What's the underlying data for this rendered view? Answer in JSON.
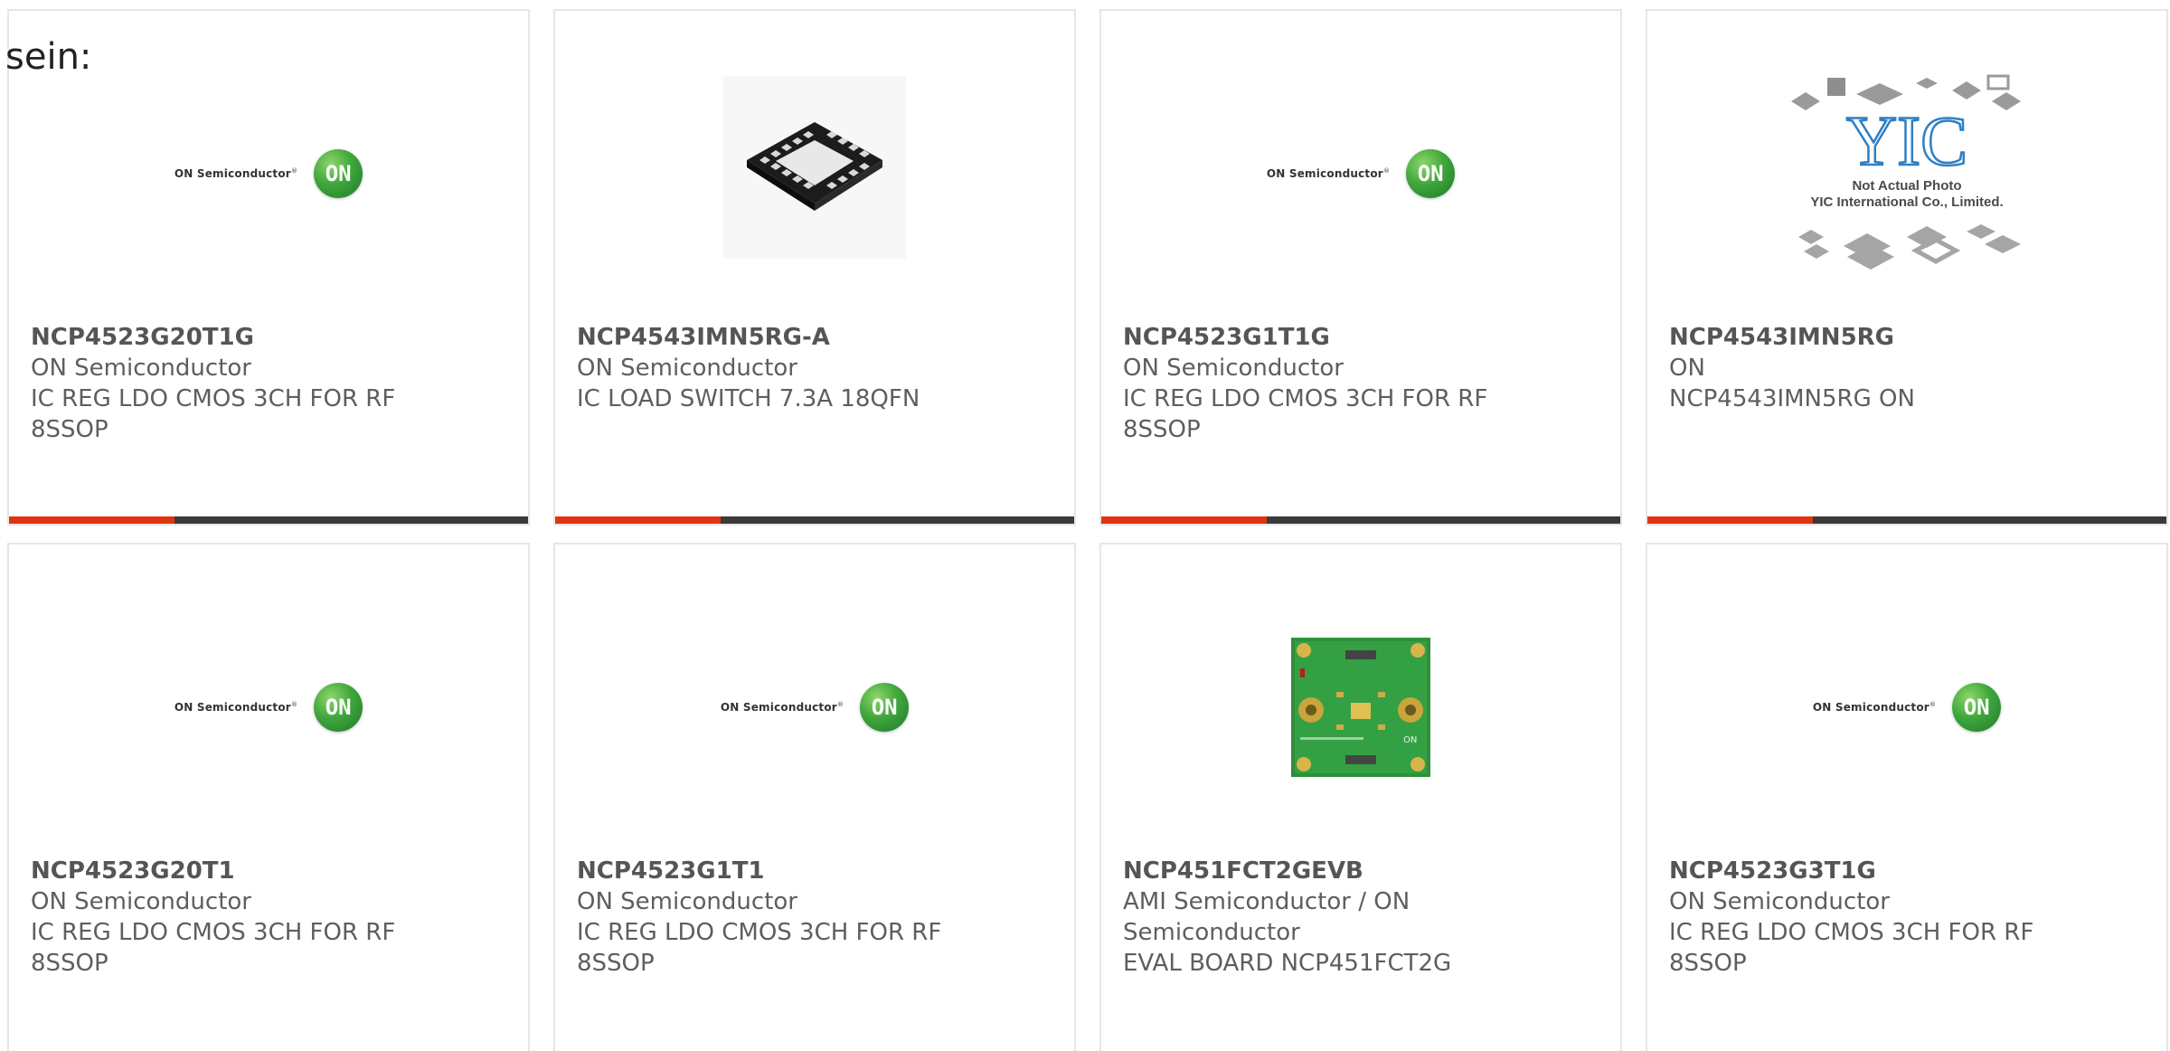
{
  "page": {
    "lead_text": "sein:"
  },
  "brand_logo": {
    "wordmark": "ON Semiconductor",
    "registered": "®",
    "disc_text": "ON",
    "disc_color": "#3fa63c"
  },
  "placeholder_image": {
    "brand": "YIC",
    "caption_line1": "Not Actual Photo",
    "caption_line2": "YIC International Co., Limited."
  },
  "board_image": {
    "silk_label": "ON"
  },
  "accent_colors": {
    "bar_accent": "#e03412",
    "bar_base": "#3a3a3a"
  },
  "products": [
    {
      "part_number": "NCP4523G20T1G",
      "manufacturer": "ON Semiconductor",
      "description": "IC REG LDO CMOS 3CH FOR RF 8SSOP",
      "image": "on-semi-logo"
    },
    {
      "part_number": "NCP4543IMN5RG-A",
      "manufacturer": "ON Semiconductor",
      "description": "IC LOAD SWITCH 7.3A 18QFN",
      "image": "qfn-chip"
    },
    {
      "part_number": "NCP4523G1T1G",
      "manufacturer": "ON Semiconductor",
      "description": "IC REG LDO CMOS 3CH FOR RF 8SSOP",
      "image": "on-semi-logo"
    },
    {
      "part_number": "NCP4543IMN5RG",
      "manufacturer": "ON",
      "description": "NCP4543IMN5RG ON",
      "image": "yic-placeholder"
    },
    {
      "part_number": "NCP4523G20T1",
      "manufacturer": "ON Semiconductor",
      "description": "IC REG LDO CMOS 3CH FOR RF 8SSOP",
      "image": "on-semi-logo"
    },
    {
      "part_number": "NCP4523G1T1",
      "manufacturer": "ON Semiconductor",
      "description": "IC REG LDO CMOS 3CH FOR RF 8SSOP",
      "image": "on-semi-logo"
    },
    {
      "part_number": "NCP451FCT2GEVB",
      "manufacturer": "AMI Semiconductor / ON Semiconductor",
      "description": "EVAL BOARD NCP451FCT2G",
      "image": "eval-board"
    },
    {
      "part_number": "NCP4523G3T1G",
      "manufacturer": "ON Semiconductor",
      "description": "IC REG LDO CMOS 3CH FOR RF 8SSOP",
      "image": "on-semi-logo"
    }
  ]
}
